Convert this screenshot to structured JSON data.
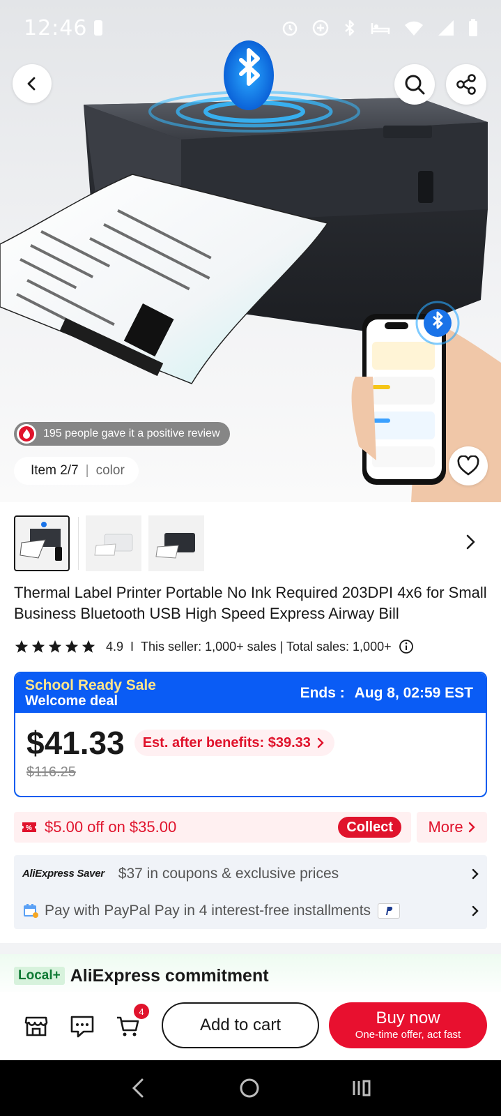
{
  "status_bar": {
    "time": "12:46"
  },
  "hero": {
    "review_text": "195 people gave it a positive review",
    "item_index": "Item 2/7",
    "item_variant": "color"
  },
  "product": {
    "title": "Thermal Label Printer Portable No Ink Required 203DPI 4x6 for Small Business Bluetooth USB High Speed Express Airway Bill",
    "rating": "4.9",
    "stars": 5,
    "sales_text": "This seller: 1,000+ sales | Total sales: 1,000+"
  },
  "promo": {
    "sale_name": "School Ready Sale",
    "deal_name": "Welcome deal",
    "ends_label": "Ends :",
    "ends_value": "Aug 8, 02:59 EST",
    "price": "$41.33",
    "est_text": "Est. after benefits: $39.33",
    "original_price": "$116.25"
  },
  "coupon": {
    "text": "$5.00 off on $35.00",
    "collect_label": "Collect",
    "more_label": "More"
  },
  "saver": {
    "logo": "AliExpress Saver",
    "text": "$37 in coupons & exclusive prices"
  },
  "paypal": {
    "text": "Pay with PayPal Pay in 4 interest-free installments"
  },
  "commitment": {
    "badge": "Local+",
    "title": "AliExpress commitment"
  },
  "action_bar": {
    "cart_count": "4",
    "add_to_cart": "Add to cart",
    "buy_now": "Buy now",
    "buy_now_sub": "One-time offer, act fast"
  },
  "colors": {
    "accent_red": "#e0132c",
    "promo_blue": "#0a5cf5",
    "sale_yellow": "#ffe58a"
  }
}
